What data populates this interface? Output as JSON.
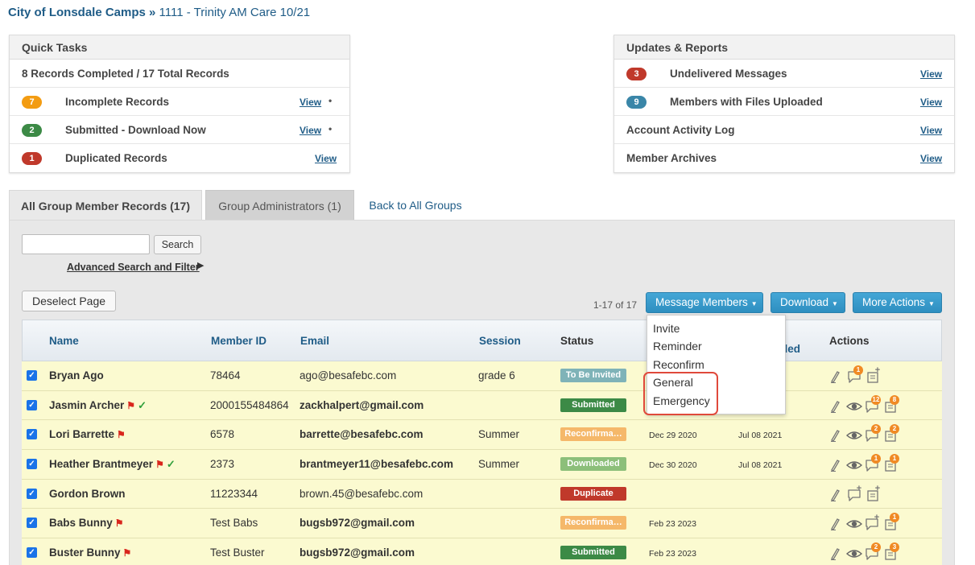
{
  "breadcrumb": {
    "org": "City of Lonsdale Camps",
    "sep": "»",
    "group": "1111 - Trinity AM Care 10/21"
  },
  "quick_tasks": {
    "title": "Quick Tasks",
    "summary": "8 Records Completed / 17 Total Records",
    "rows": [
      {
        "badge": "7",
        "badge_color": "#f39c12",
        "label": "Incomplete Records",
        "link": "View",
        "dot": "•"
      },
      {
        "badge": "2",
        "badge_color": "#3c8a46",
        "label": "Submitted - Download Now",
        "link": "View",
        "dot": "•"
      },
      {
        "badge": "1",
        "badge_color": "#c0392b",
        "label": "Duplicated Records",
        "link": "View",
        "dot": ""
      }
    ]
  },
  "updates": {
    "title": "Updates & Reports",
    "rows": [
      {
        "badge": "3",
        "badge_color": "#c0392b",
        "label": "Undelivered Messages",
        "link": "View"
      },
      {
        "badge": "9",
        "badge_color": "#3a86a8",
        "label": "Members with Files Uploaded",
        "link": "View"
      },
      {
        "badge": "",
        "badge_color": "",
        "label": "Account Activity Log",
        "link": "View"
      },
      {
        "badge": "",
        "badge_color": "",
        "label": "Member Archives",
        "link": "View"
      }
    ]
  },
  "tabs": {
    "all": "All Group Member Records (17)",
    "admins": "Group Administrators (1)",
    "back": "Back to All Groups"
  },
  "search": {
    "placeholder": "",
    "button": "Search",
    "advanced": "Advanced Search and Filter",
    "advanced_arrow": "▶"
  },
  "toolbar": {
    "deselect": "Deselect Page",
    "count": "1-17 of 17",
    "message": "Message Members",
    "download": "Download",
    "more": "More Actions"
  },
  "table": {
    "headers": {
      "name": "Name",
      "member_id": "Member ID",
      "email": "Email",
      "session": "Session",
      "status": "Status",
      "hidden_col": "ded",
      "actions": "Actions"
    },
    "rows": [
      {
        "name": "Bryan Ago",
        "flag": false,
        "check": false,
        "member_id": "78464",
        "email": "ago@besafebc.com",
        "email_bold": false,
        "session": "grade 6",
        "status": "To Be Invited",
        "status_color": "#7fb3b8",
        "date1": "",
        "date2": "",
        "badge1": "1",
        "badge2": ""
      },
      {
        "name": "Jasmin Archer",
        "flag": true,
        "check": true,
        "member_id": "2000155484864",
        "email": "zackhalpert@gmail.com",
        "email_bold": true,
        "session": "",
        "status": "Submitted",
        "status_color": "#3c8a46",
        "date1": "",
        "date2": "",
        "badge1": "12",
        "badge2": "8"
      },
      {
        "name": "Lori Barrette",
        "flag": true,
        "check": false,
        "member_id": "6578",
        "email": "barrette@besafebc.com",
        "email_bold": true,
        "session": "Summer",
        "status": "Reconfirma…",
        "status_color": "#f5b86a",
        "date1": "Dec 29 2020",
        "date2": "Jul 08 2021",
        "badge1": "2",
        "badge2": "2"
      },
      {
        "name": "Heather Brantmeyer",
        "flag": true,
        "check": true,
        "member_id": "2373",
        "email": "brantmeyer11@besafebc.com",
        "email_bold": true,
        "session": "Summer",
        "status": "Downloaded",
        "status_color": "#8cbf7a",
        "date1": "Dec 30 2020",
        "date2": "Jul 08 2021",
        "badge1": "1",
        "badge2": "1"
      },
      {
        "name": "Gordon Brown",
        "flag": false,
        "check": false,
        "member_id": "11223344",
        "email": "brown.45@besafebc.com",
        "email_bold": false,
        "session": "",
        "status": "Duplicate",
        "status_color": "#c0392b",
        "date1": "",
        "date2": "",
        "badge1": "",
        "badge2": ""
      },
      {
        "name": "Babs Bunny",
        "flag": true,
        "check": false,
        "member_id": "Test Babs",
        "email": "bugsb972@gmail.com",
        "email_bold": true,
        "session": "",
        "status": "Reconfirma…",
        "status_color": "#f5b86a",
        "date1": "Feb 23 2023",
        "date2": "",
        "badge1": "",
        "badge2": "1"
      },
      {
        "name": "Buster Bunny",
        "flag": true,
        "check": false,
        "member_id": "Test Buster",
        "email": "bugsb972@gmail.com",
        "email_bold": true,
        "session": "",
        "status": "Submitted",
        "status_color": "#3c8a46",
        "date1": "Feb 23 2023",
        "date2": "",
        "badge1": "2",
        "badge2": "3"
      }
    ]
  },
  "dropdown": {
    "items": [
      "Invite",
      "Reminder",
      "Reconfirm",
      "General",
      "Emergency"
    ]
  }
}
